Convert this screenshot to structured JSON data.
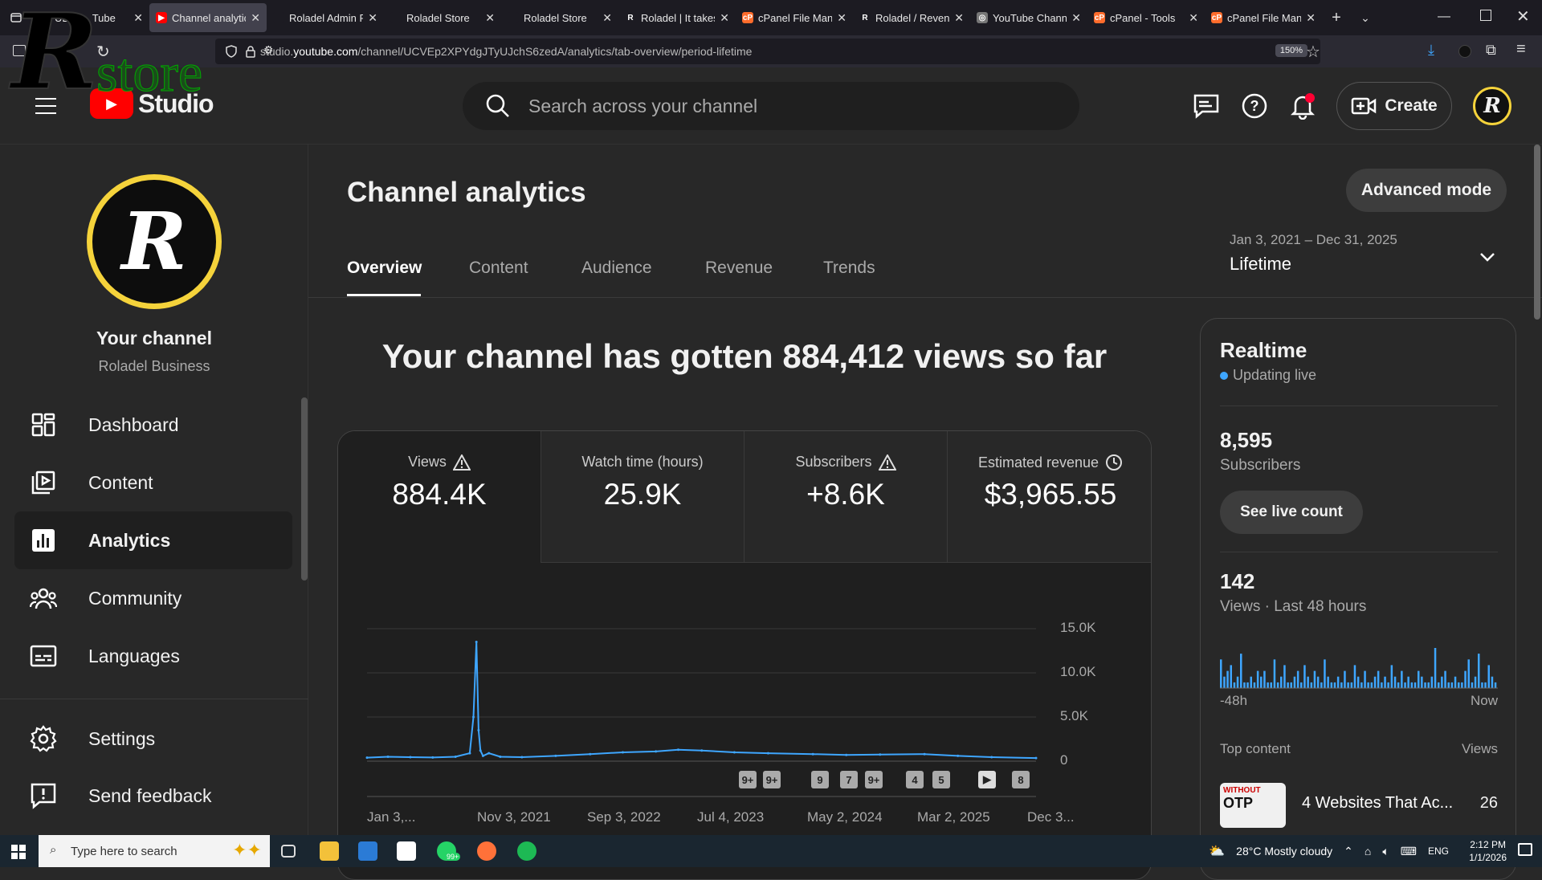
{
  "browser": {
    "tabs": [
      {
        "title": "UBE … Tube",
        "fav_color": "#1c1b22",
        "fav_text": ""
      },
      {
        "title": "Channel analytic",
        "fav_color": "#ff0000",
        "fav_text": "▶",
        "active": true
      },
      {
        "title": "Roladel Admin Panel",
        "fav_color": "#1c1b22",
        "fav_text": ""
      },
      {
        "title": "Roladel Store",
        "fav_color": "#1c1b22",
        "fav_text": ""
      },
      {
        "title": "Roladel Store",
        "fav_color": "#1c1b22",
        "fav_text": ""
      },
      {
        "title": "Roladel | It takes",
        "fav_color": "#1c1b22",
        "fav_text": "R"
      },
      {
        "title": "cPanel File Mana",
        "fav_color": "#ff6c2c",
        "fav_text": "cP"
      },
      {
        "title": "Roladel / Revenu",
        "fav_color": "#1c1b22",
        "fav_text": "R"
      },
      {
        "title": "YouTube Channe",
        "fav_color": "#777777",
        "fav_text": "◎"
      },
      {
        "title": "cPanel - Tools",
        "fav_color": "#ff6c2c",
        "fav_text": "cP"
      },
      {
        "title": "cPanel File Mana",
        "fav_color": "#ff6c2c",
        "fav_text": "cP"
      }
    ],
    "url_prefix": "studio.",
    "url_domain": "youtube.com",
    "url_path": "/channel/UCVEp2XPYdgJTyUJchS6zedA/analytics/tab-overview/period-lifetime",
    "zoom": "150%"
  },
  "watermark": {
    "letter": "R",
    "word": "store"
  },
  "header": {
    "logo_text": "Studio",
    "search_placeholder": "Search across your channel",
    "create_label": "Create",
    "avatar_letter": "R"
  },
  "sidebar": {
    "avatar_letter": "R",
    "channel_title": "Your channel",
    "channel_name": "Roladel Business",
    "items": [
      {
        "label": "Dashboard",
        "icon": "dashboard-icon"
      },
      {
        "label": "Content",
        "icon": "content-icon"
      },
      {
        "label": "Analytics",
        "icon": "analytics-icon",
        "active": true
      },
      {
        "label": "Community",
        "icon": "community-icon"
      },
      {
        "label": "Languages",
        "icon": "languages-icon"
      }
    ],
    "bottom_items": [
      {
        "label": "Settings",
        "icon": "gear-icon"
      },
      {
        "label": "Send feedback",
        "icon": "feedback-icon"
      }
    ]
  },
  "main": {
    "title": "Channel analytics",
    "advanced_mode": "Advanced mode",
    "tabs": [
      "Overview",
      "Content",
      "Audience",
      "Revenue",
      "Trends"
    ],
    "date_range": "Jan 3, 2021 – Dec 31, 2025",
    "period": "Lifetime",
    "headline": "Your channel has gotten 884,412 views so far",
    "metrics": [
      {
        "label": "Views",
        "value": "884.4K",
        "icon": "warning-icon"
      },
      {
        "label": "Watch time (hours)",
        "value": "25.9K",
        "icon": ""
      },
      {
        "label": "Subscribers",
        "value": "+8.6K",
        "icon": "warning-icon"
      },
      {
        "label": "Estimated revenue",
        "value": "$3,965.55",
        "icon": "clock-icon"
      }
    ],
    "markers": [
      "9+",
      "9+",
      "9",
      "7",
      "9+",
      "4",
      "5",
      "▶",
      "8"
    ]
  },
  "chart_data": {
    "type": "line",
    "color": "#3ea6ff",
    "title": "",
    "xlabel": "",
    "ylabel": "",
    "ylim": [
      0,
      15000
    ],
    "yticks": [
      "0",
      "5.0K",
      "10.0K",
      "15.0K"
    ],
    "xticks": [
      "Jan 3,...",
      "Nov 3, 2021",
      "Sep 3, 2022",
      "Jul 4, 2023",
      "May 2, 2024",
      "Mar 2, 2025",
      "Dec 3..."
    ],
    "x": [
      "2021-01-03",
      "2021-03-01",
      "2021-05-01",
      "2021-07-01",
      "2021-09-01",
      "2021-10-10",
      "2021-10-20",
      "2021-10-28",
      "2021-11-03",
      "2021-11-08",
      "2021-11-15",
      "2021-12-01",
      "2022-01-01",
      "2022-03-01",
      "2022-06-01",
      "2022-09-03",
      "2022-12-01",
      "2023-03-01",
      "2023-05-01",
      "2023-07-04",
      "2023-10-01",
      "2024-01-01",
      "2024-05-02",
      "2024-08-01",
      "2024-11-01",
      "2025-03-02",
      "2025-06-01",
      "2025-09-01",
      "2025-12-31"
    ],
    "y": [
      400,
      500,
      450,
      420,
      500,
      900,
      5000,
      13500,
      3500,
      1200,
      600,
      900,
      500,
      450,
      600,
      800,
      1000,
      1100,
      1300,
      1200,
      1000,
      900,
      800,
      700,
      750,
      800,
      600,
      450,
      350
    ]
  },
  "realtime": {
    "title": "Realtime",
    "live_text": "Updating live",
    "subscribers": "8,595",
    "subscribers_label": "Subscribers",
    "live_count_btn": "See live count",
    "views": "142",
    "views_label": "Views · Last 48 hours",
    "left_label": "-48h",
    "right_label": "Now",
    "bars": [
      5,
      2,
      3,
      4,
      1,
      2,
      6,
      1,
      1,
      2,
      1,
      3,
      2,
      3,
      1,
      1,
      5,
      1,
      2,
      4,
      1,
      1,
      2,
      3,
      1,
      4,
      2,
      1,
      3,
      2,
      1,
      5,
      2,
      1,
      1,
      2,
      1,
      3,
      1,
      1,
      4,
      2,
      1,
      3,
      1,
      1,
      2,
      3,
      1,
      2,
      1,
      4,
      2,
      1,
      3,
      1,
      2,
      1,
      1,
      3,
      2,
      1,
      1,
      2,
      7,
      1,
      2,
      3,
      1,
      1,
      2,
      1,
      1,
      3,
      5,
      1,
      2,
      6,
      1,
      1,
      4,
      2,
      1
    ],
    "top_content_label": "Top content",
    "top_content_views_label": "Views",
    "top_item_title": "4 Websites That Ac...",
    "top_item_views": "26",
    "thumb_text_1": "WITHOUT",
    "thumb_text_2": "OTP"
  },
  "taskbar": {
    "search_placeholder": "Type here to search",
    "weather": "28°C  Mostly cloudy",
    "lang": "ENG",
    "time": "2:12 PM",
    "date": "1/1/2026",
    "badge": "99+"
  }
}
